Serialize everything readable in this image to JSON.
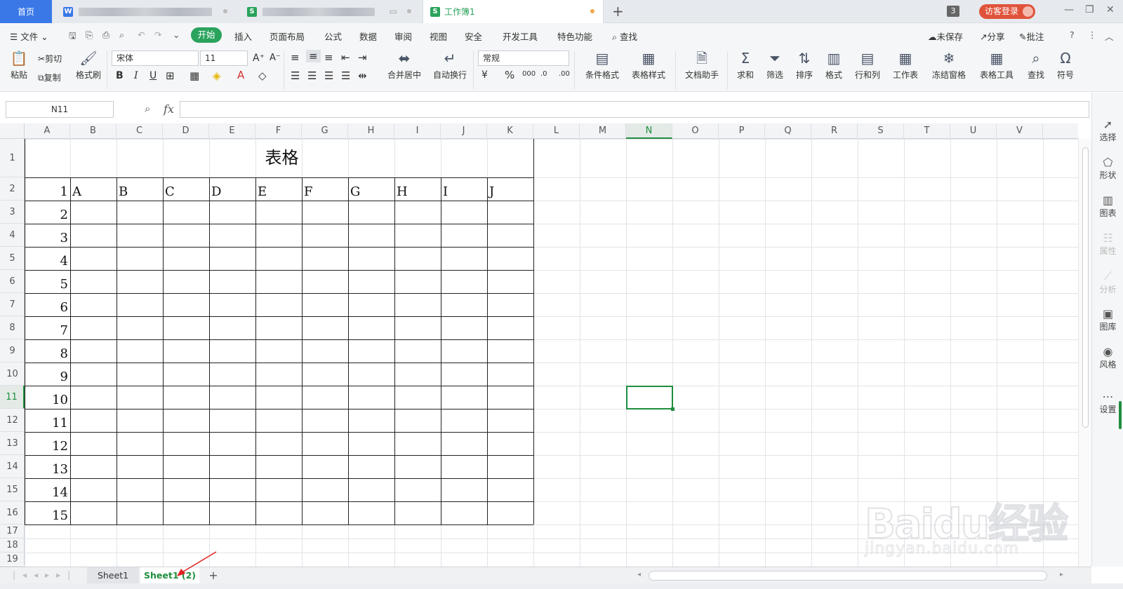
{
  "titlebar": {
    "home_tab": "首页",
    "active_tab": "工作簿1",
    "new_tab": "+",
    "count_badge": "3",
    "login": "访客登录",
    "colors": {
      "home": "#3a78e8",
      "login": "#e0533b",
      "modified_dot": "#f0a54a"
    }
  },
  "menu": {
    "file": "文件",
    "start": "开始",
    "items": [
      "插入",
      "页面布局",
      "公式",
      "数据",
      "审阅",
      "视图",
      "安全",
      "开发工具",
      "特色功能"
    ],
    "search": "查找",
    "unsaved": "未保存",
    "share": "分享",
    "comment": "批注"
  },
  "ribbon": {
    "paste": "粘贴",
    "cut": "剪切",
    "copy": "复制",
    "format_painter": "格式刷",
    "font_name": "宋体",
    "font_size": "11",
    "bold": "B",
    "italic": "I",
    "underline": "U",
    "merge_center": "合并居中",
    "wrap": "自动换行",
    "number_format": "常规",
    "percent": "%",
    "thousands": "000",
    "cond_format": "条件格式",
    "table_style": "表格样式",
    "doc_helper": "文档助手",
    "sum": "求和",
    "filter": "筛选",
    "sort": "排序",
    "format": "格式",
    "row_col": "行和列",
    "worksheet": "工作表",
    "freeze": "冻结窗格",
    "table_tools": "表格工具",
    "find": "查找",
    "symbol": "符号"
  },
  "formula": {
    "name_box": "N11",
    "fx": "fx",
    "value": ""
  },
  "columns": [
    "A",
    "B",
    "C",
    "D",
    "E",
    "F",
    "G",
    "H",
    "I",
    "J",
    "K",
    "L",
    "M",
    "N",
    "O",
    "P",
    "Q",
    "R",
    "S",
    "T",
    "U",
    "V"
  ],
  "rows": [
    "1",
    "2",
    "3",
    "4",
    "5",
    "6",
    "7",
    "8",
    "9",
    "10",
    "11",
    "12",
    "13",
    "14",
    "15",
    "16",
    "17",
    "18",
    "19"
  ],
  "selected": {
    "column": "N",
    "row": "11"
  },
  "table": {
    "title": "表格",
    "header_row": [
      "1",
      "A",
      "B",
      "C",
      "D",
      "E",
      "F",
      "G",
      "H",
      "I",
      "J"
    ],
    "row_numbers": [
      "2",
      "3",
      "4",
      "5",
      "6",
      "7",
      "8",
      "9",
      "10",
      "11",
      "12",
      "13",
      "14",
      "15"
    ]
  },
  "right_panel": [
    "选择",
    "形状",
    "图表",
    "属性",
    "分析",
    "图库",
    "风格",
    "设置"
  ],
  "sheets": [
    "Sheet1",
    "Sheet1 (2)"
  ],
  "sheet_add": "+",
  "watermark": {
    "main": "Baidu经验",
    "sub": "jingyan.baidu.com"
  }
}
